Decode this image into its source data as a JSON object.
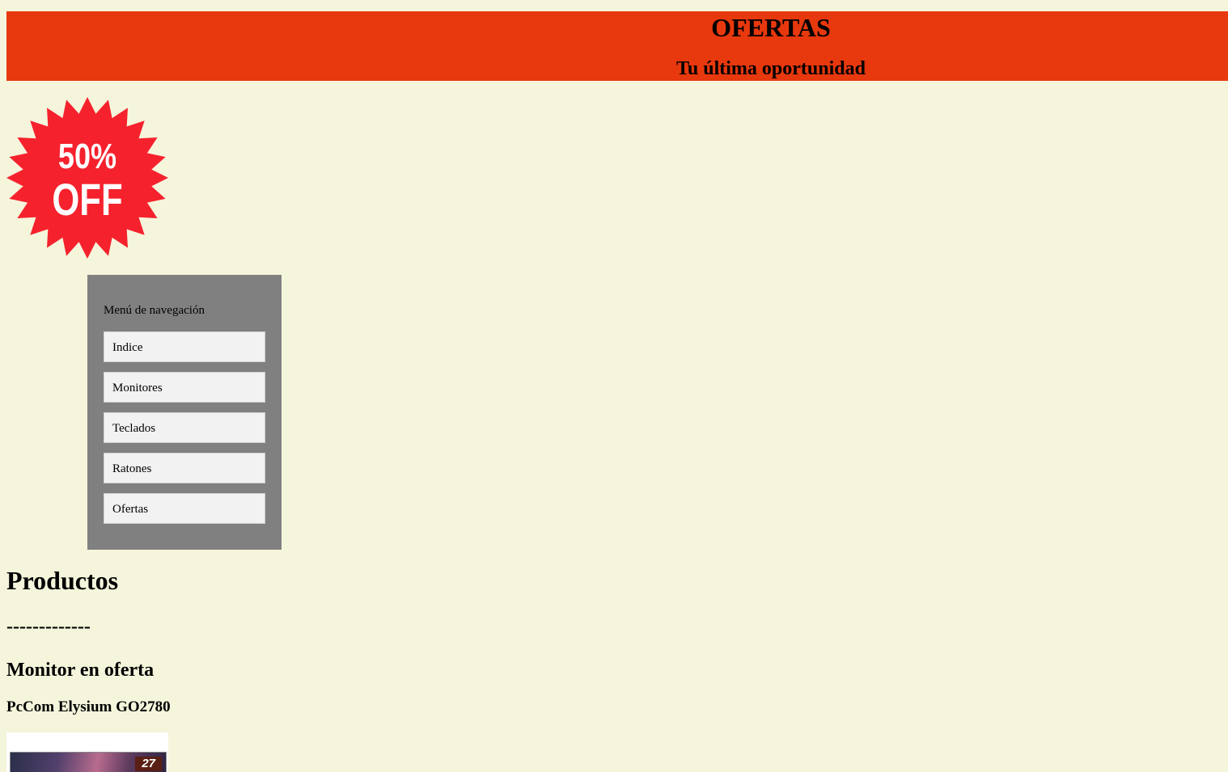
{
  "header": {
    "title": "OFERTAS",
    "subtitle": "Tu última oportunidad"
  },
  "badge": {
    "icon": "discount-starburst-icon",
    "line1": "50%",
    "line2": "OFF",
    "color": "#f5222d"
  },
  "nav": {
    "title": "Menú de navegación",
    "items": [
      {
        "label": "Indice"
      },
      {
        "label": "Monitores"
      },
      {
        "label": "Teclados"
      },
      {
        "label": "Ratones"
      },
      {
        "label": "Ofertas"
      }
    ]
  },
  "main": {
    "heading": "Productos",
    "separator": "-------------",
    "section_title": "Monitor en oferta",
    "product_name": "PcCom Elysium GO2780",
    "product_image_badge": "27"
  },
  "colors": {
    "page_background": "#f5f5dc",
    "header_background": "#e8380d",
    "nav_background": "#808080"
  }
}
